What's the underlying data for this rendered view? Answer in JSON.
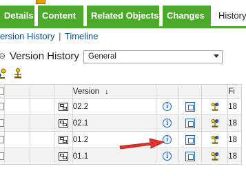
{
  "tabs": [
    {
      "label": "Details"
    },
    {
      "label": "Content"
    },
    {
      "label": "Related Objects"
    },
    {
      "label": "Changes"
    },
    {
      "label": "History"
    }
  ],
  "subnav": {
    "version_history": "ersion History",
    "separator": "|",
    "timeline": "Timeline"
  },
  "section": {
    "collapse": "⊖",
    "title": "Version History",
    "view_selected": "General"
  },
  "table": {
    "header": {
      "version": "Version",
      "sort_arrow": "↓",
      "file": "Fi"
    },
    "rows": [
      {
        "version": "02.2",
        "file": "18"
      },
      {
        "version": "02.1",
        "file": "18"
      },
      {
        "version": "01.2",
        "file": "18"
      },
      {
        "version": "01.1",
        "file": "18"
      }
    ]
  },
  "icons": {
    "info": "i",
    "brand_green": "#4caa2b",
    "link_blue": "#0b4f8a",
    "arrow_red": "#e0332b"
  }
}
